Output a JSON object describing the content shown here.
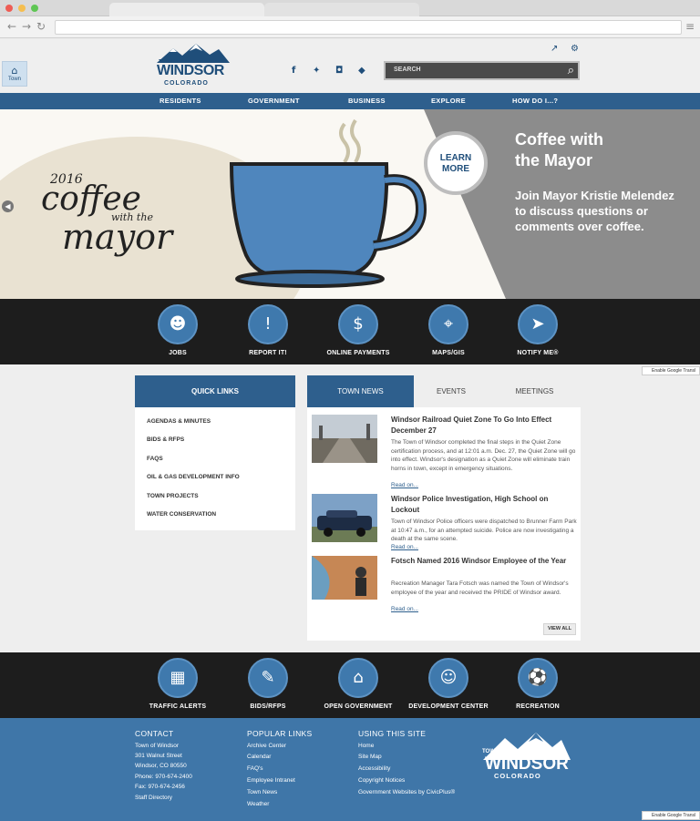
{
  "header": {
    "home_label": "Town",
    "logo_town": "TOWN OF",
    "logo_name": "WINDSOR",
    "logo_state": "COLORADO",
    "search_placeholder": "SEARCH"
  },
  "nav": [
    "RESIDENTS",
    "GOVERNMENT",
    "BUSINESS",
    "EXPLORE",
    "HOW DO I...?"
  ],
  "hero": {
    "year": "2016",
    "coffee": "coffee",
    "with_the": "with the",
    "mayor": "mayor",
    "learn_more": "LEARN MORE",
    "title_line1": "Coffee with",
    "title_line2": "the Mayor",
    "body": "Join Mayor Kristie Melendez to discuss questions or comments over coffee."
  },
  "top_band": [
    {
      "label": "JOBS",
      "icon": "person-icon"
    },
    {
      "label": "REPORT IT!",
      "icon": "alert-chat-icon"
    },
    {
      "label": "ONLINE PAYMENTS",
      "icon": "payment-icon"
    },
    {
      "label": "MAPS/GIS",
      "icon": "map-pin-icon"
    },
    {
      "label": "NOTIFY ME®",
      "icon": "paper-plane-icon"
    }
  ],
  "translate": "Enable Google Transl",
  "quick_links": {
    "title": "QUICK LINKS",
    "items": [
      "AGENDAS & MINUTES",
      "BIDS & RFPS",
      "FAQS",
      "OIL & GAS DEVELOPMENT INFO",
      "TOWN PROJECTS",
      "WATER CONSERVATION"
    ]
  },
  "tabs": [
    "TOWN NEWS",
    "EVENTS",
    "MEETINGS"
  ],
  "news": [
    {
      "title": "Windsor Railroad Quiet Zone To Go Into Effect December 27",
      "body": "The Town of Windsor completed the final steps in the Quiet Zone certification process, and at 12:01 a.m. Dec. 27, the Quiet Zone will go into effect. Windsor's designation as a Quiet Zone will eliminate train horns in town, except in emergency situations.",
      "more": "Read on..."
    },
    {
      "title": "Windsor Police Investigation, High School on Lockout",
      "body": "Town of Windsor Police officers were dispatched to Brunner Farm Park at 10:47 a.m., for an attempted suicide. Police are now investigating a death at the same scene.",
      "more": "Read on..."
    },
    {
      "title": "Fotsch Named 2016 Windsor Employee of the Year",
      "body": "Recreation Manager Tara Fotsch was named the Town of Windsor's employee of the year and received the PRIDE of Windsor award.",
      "more": "Read on..."
    }
  ],
  "view_all": "VIEW ALL",
  "bottom_band": [
    {
      "label": "TRAFFIC ALERTS",
      "icon": "barricade-icon"
    },
    {
      "label": "BIDS/RFPS",
      "icon": "document-pen-icon"
    },
    {
      "label": "OPEN GOVERNMENT",
      "icon": "government-building-icon"
    },
    {
      "label": "DEVELOPMENT CENTER",
      "icon": "worker-icon"
    },
    {
      "label": "RECREATION",
      "icon": "soccer-ball-icon"
    }
  ],
  "footer": {
    "contact": {
      "title": "CONTACT",
      "lines": [
        "Town of Windsor",
        "301 Walnut Street",
        "Windsor, CO 80550",
        "Phone: 970-674-2400",
        "Fax: 970-674-2456",
        "Staff Directory"
      ]
    },
    "popular": {
      "title": "POPULAR LINKS",
      "lines": [
        "Archive Center",
        "Calendar",
        "FAQ's",
        "Employee Intranet",
        "Town News",
        "Weather"
      ]
    },
    "using": {
      "title": "USING THIS SITE",
      "lines": [
        "Home",
        "Site Map",
        "Accessibility",
        "Copyright Notices",
        "Government Websites by CivicPlus®"
      ]
    },
    "logo_town": "TOWN OF",
    "logo_name": "WINDSOR",
    "logo_state": "COLORADO"
  },
  "colors": {
    "brand_blue": "#2e5f8d",
    "footer_blue": "#3f76a8",
    "band_black": "#1d1d1d"
  }
}
